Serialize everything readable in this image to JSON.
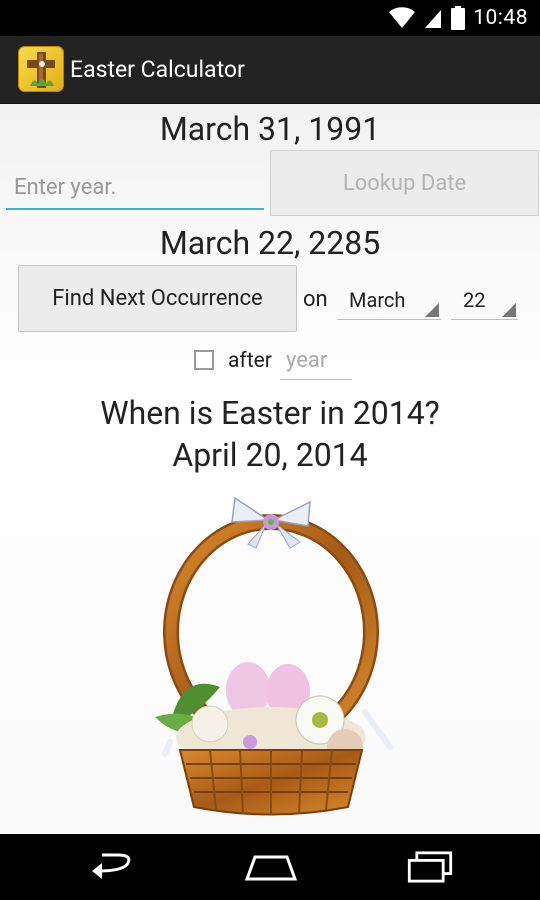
{
  "status_bar": {
    "time": "10:48",
    "icons": [
      "wifi-icon",
      "cell-signal-icon",
      "battery-icon"
    ]
  },
  "action_bar": {
    "title": "Easter Calculator",
    "icon": "cross-app-icon"
  },
  "main": {
    "lookup_result": "March 31, 1991",
    "year_input": {
      "value": "",
      "placeholder": "Enter year."
    },
    "lookup_button": "Lookup Date",
    "occurrence_result": "March 22, 2285",
    "find_button": "Find Next Occurrence",
    "on_label": "on",
    "month_select": "March",
    "day_select": "22",
    "after_checkbox": {
      "checked": false,
      "label": "after"
    },
    "after_year_input": {
      "value": "",
      "placeholder": "year"
    },
    "question": "When is Easter in 2014?",
    "answer": "April 20, 2014",
    "image": "easter-basket-image"
  },
  "nav_bar": {
    "back": "back-icon",
    "home": "home-icon",
    "recents": "recent-apps-icon"
  },
  "colors": {
    "accent": "#33b5e5",
    "action_bar": "#222222",
    "app_icon": "#f2c21b"
  }
}
